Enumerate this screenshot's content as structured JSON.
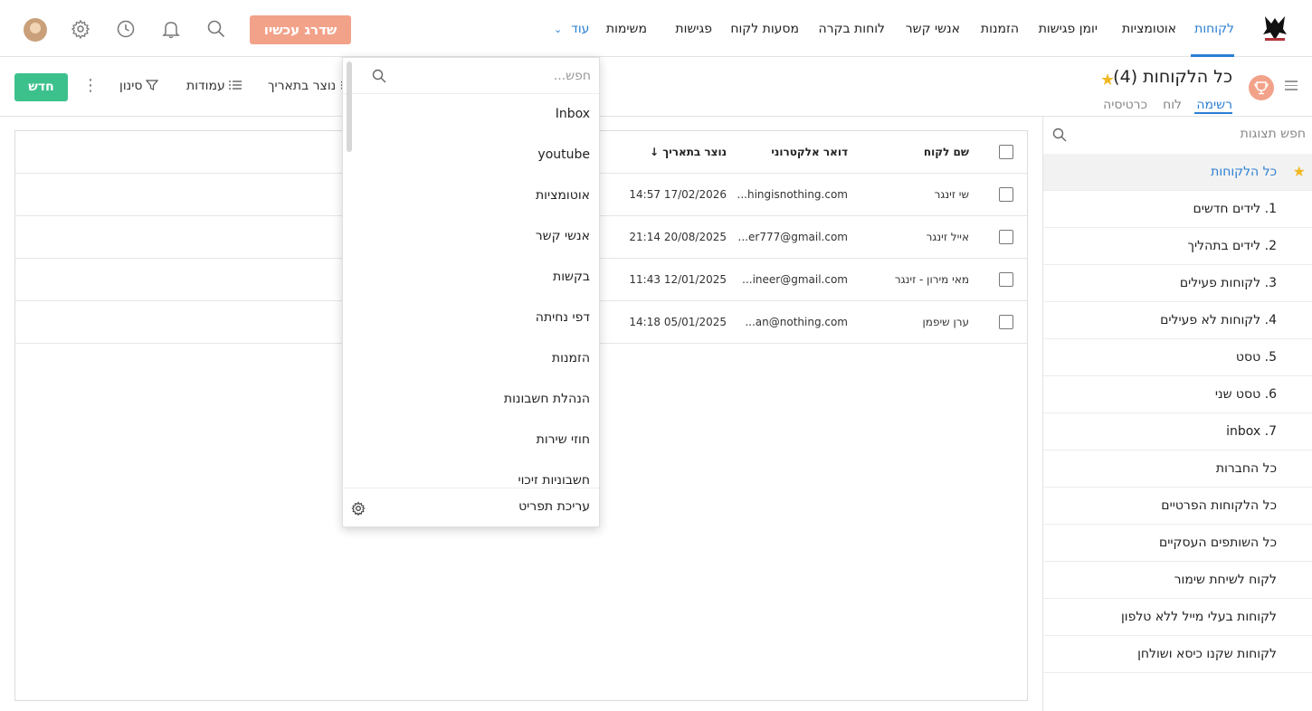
{
  "nav": {
    "items": [
      "לקוחות",
      "אוטומציות",
      "יומן פגישות",
      "הזמנות",
      "אנשי קשר",
      "לוחות בקרה",
      "מסעות לקוח",
      "פגישות",
      "משימות"
    ],
    "more_label": "עוד",
    "upgrade_label": "שדרג עכשיו",
    "active_color": "#2b7fd3",
    "icons": [
      "search-icon",
      "bell-icon",
      "clock-icon",
      "gear-icon",
      "avatar"
    ]
  },
  "toolbar": {
    "new_label": "חדש",
    "filter_label": "סינון",
    "columns_label": "עמודות",
    "sort_label": "נוצר בתאריך",
    "title": "כל הלקוחות",
    "count": "(4)",
    "views": [
      "רשימה",
      "לוח",
      "כרטיסיה"
    ]
  },
  "sidebar": {
    "search_label": "חפש תצוגות",
    "items": [
      "כל הלקוחות",
      "1. לידים חדשים",
      "2. לידים בתהליך",
      "3. לקוחות פעילים",
      "4. לקוחות לא פעילים",
      "5. טסט",
      "6. טסט שני",
      "7. inbox",
      "כל החברות",
      "כל הלקוחות הפרטיים",
      "כל השותפים העסקיים",
      "לקוח לשיחת שימור",
      "לקוחות בעלי מייל ללא טלפון",
      "לקוחות שקנו כיסא ושולחן"
    ]
  },
  "table": {
    "headers": {
      "name": "שם לקוח",
      "email": "דואר אלקטרוני",
      "created": "נוצר בתאריך"
    },
    "rows": [
      {
        "name": "שי זינגר",
        "email": "hingisnothing.com...",
        "created": "17/02/2026 14:57"
      },
      {
        "name": "אייל זינגר",
        "email": "er777@gmail.com...",
        "created": "20/08/2025 21:14"
      },
      {
        "name": "מאי מירון - זינגר",
        "email": "ineer@gmail.com...",
        "created": "12/01/2025 11:43"
      },
      {
        "name": "ערן שיפמן",
        "email": "an@nothing.com...",
        "created": "05/01/2025 14:18"
      }
    ]
  },
  "dropdown": {
    "search_placeholder": "חפש...",
    "items": [
      "Inbox",
      "youtube",
      "אוטומציות",
      "אנשי קשר",
      "בקשות",
      "דפי נחיתה",
      "הזמנות",
      "הנהלת חשבונות",
      "חוזי שירות",
      "חשבוניות זיכוי"
    ],
    "footer_label": "עריכת תפריט"
  }
}
